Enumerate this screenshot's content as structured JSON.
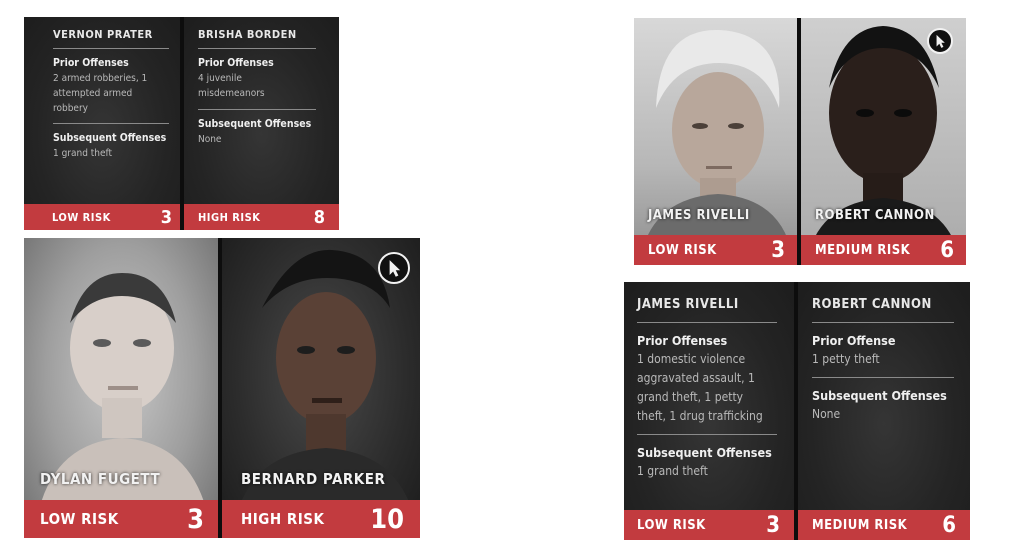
{
  "top_left": {
    "cards": [
      {
        "name": "VERNON PRATER",
        "prior_heading": "Prior Offenses",
        "prior_lines": [
          "2 armed robberies, 1",
          "attempted armed",
          "robbery"
        ],
        "subsequent_heading": "Subsequent Offenses",
        "subsequent_lines": [
          "1 grand theft"
        ],
        "risk_label": "LOW RISK",
        "risk_score": "3"
      },
      {
        "name": "BRISHA BORDEN",
        "prior_heading": "Prior Offenses",
        "prior_lines": [
          "4 juvenile",
          "misdemeanors"
        ],
        "subsequent_heading": "Subsequent Offenses",
        "subsequent_lines": [
          "None"
        ],
        "risk_label": "HIGH RISK",
        "risk_score": "8"
      }
    ]
  },
  "bottom_left": {
    "cards": [
      {
        "name": "DYLAN FUGETT",
        "risk_label": "LOW RISK",
        "risk_score": "3"
      },
      {
        "name": "BERNARD PARKER",
        "risk_label": "HIGH RISK",
        "risk_score": "10"
      }
    ]
  },
  "top_right": {
    "cards": [
      {
        "name": "JAMES RIVELLI",
        "risk_label": "LOW RISK",
        "risk_score": "3"
      },
      {
        "name": "ROBERT CANNON",
        "risk_label": "MEDIUM RISK",
        "risk_score": "6"
      }
    ]
  },
  "bottom_right": {
    "cards": [
      {
        "name": "JAMES RIVELLI",
        "prior_heading": "Prior Offenses",
        "prior_lines": [
          "1 domestic violence",
          "aggravated assault, 1",
          "grand theft, 1 petty",
          "theft, 1 drug trafficking"
        ],
        "subsequent_heading": "Subsequent Offenses",
        "subsequent_lines": [
          "1 grand theft"
        ],
        "risk_label": "LOW RISK",
        "risk_score": "3"
      },
      {
        "name": "ROBERT CANNON",
        "prior_heading": "Prior Offense",
        "prior_lines": [
          "1 petty theft"
        ],
        "subsequent_heading": "Subsequent Offenses",
        "subsequent_lines": [
          "None"
        ],
        "risk_label": "MEDIUM RISK",
        "risk_score": "6"
      }
    ]
  },
  "icons": {
    "cursor": "cursor-arrow-icon"
  },
  "colors": {
    "risk_bar": "#c23b3f",
    "panel": "#1b1b1b"
  }
}
